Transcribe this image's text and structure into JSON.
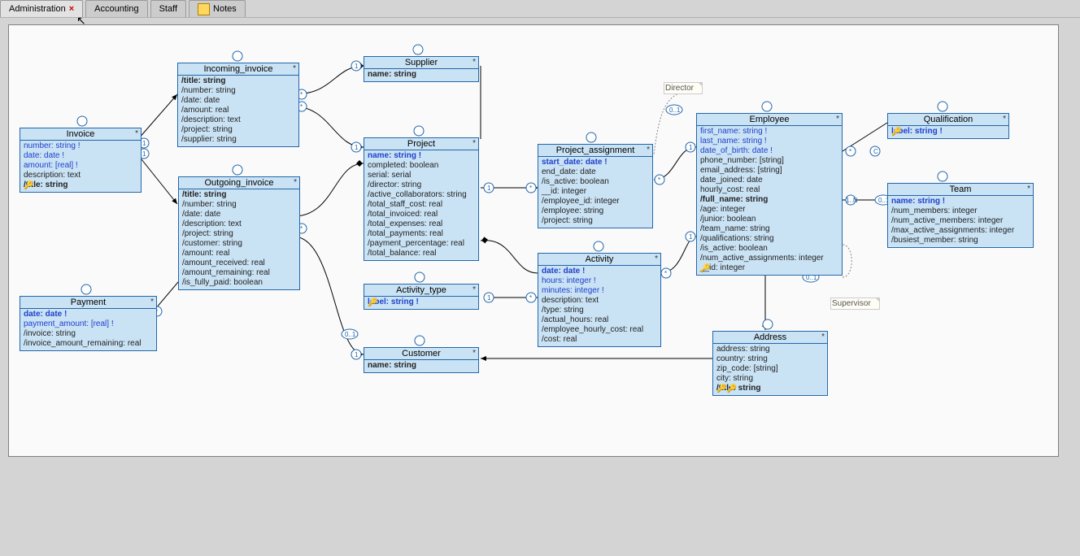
{
  "tabs": [
    "Administration",
    "Accounting",
    "Staff",
    "Notes"
  ],
  "labels": {
    "director": "Director",
    "supervisor": "Supervisor"
  },
  "entities": {
    "invoice": {
      "title": "Invoice",
      "attrs": [
        {
          "t": "number: string !",
          "blue": true
        },
        {
          "t": "date: date !",
          "blue": true
        },
        {
          "t": "amount: [real] !",
          "blue": true
        },
        {
          "t": "description: text"
        },
        {
          "t": "/title: string",
          "bold": true
        }
      ]
    },
    "incoming": {
      "title": "Incoming_invoice",
      "attrs": [
        {
          "t": "/title: string",
          "bold": true
        },
        {
          "t": "/number: string"
        },
        {
          "t": "/date: date"
        },
        {
          "t": "/amount: real"
        },
        {
          "t": "/description: text"
        },
        {
          "t": "/project: string"
        },
        {
          "t": "/supplier: string"
        }
      ]
    },
    "outgoing": {
      "title": "Outgoing_invoice",
      "attrs": [
        {
          "t": "/title: string",
          "bold": true
        },
        {
          "t": "/number: string"
        },
        {
          "t": "/date: date"
        },
        {
          "t": "/description: text"
        },
        {
          "t": "/project: string"
        },
        {
          "t": "/customer: string"
        },
        {
          "t": "/amount: real"
        },
        {
          "t": "/amount_received: real"
        },
        {
          "t": "/amount_remaining: real"
        },
        {
          "t": "/is_fully_paid: boolean"
        }
      ]
    },
    "payment": {
      "title": "Payment",
      "attrs": [
        {
          "t": "date: date !",
          "blue": true,
          "bold": true
        },
        {
          "t": "payment_amount: [real] !",
          "blue": true
        },
        {
          "t": "/invoice: string"
        },
        {
          "t": "/invoice_amount_remaining: real"
        }
      ]
    },
    "supplier": {
      "title": "Supplier",
      "attrs": [
        {
          "t": "name: string",
          "bold": true
        }
      ]
    },
    "project": {
      "title": "Project",
      "attrs": [
        {
          "t": "name: string !",
          "blue": true,
          "bold": true
        },
        {
          "t": "completed: boolean"
        },
        {
          "t": "serial: serial"
        },
        {
          "t": "/director: string"
        },
        {
          "t": "/active_collaborators: string"
        },
        {
          "t": "/total_staff_cost: real"
        },
        {
          "t": "/total_invoiced: real"
        },
        {
          "t": "/total_expenses: real"
        },
        {
          "t": "/total_payments: real"
        },
        {
          "t": "/payment_percentage: real"
        },
        {
          "t": "/total_balance: real"
        }
      ]
    },
    "customer": {
      "title": "Customer",
      "attrs": [
        {
          "t": "name: string",
          "bold": true
        }
      ]
    },
    "activitytype": {
      "title": "Activity_type",
      "attrs": [
        {
          "t": "label: string !",
          "blue": true,
          "bold": true
        }
      ]
    },
    "activity": {
      "title": "Activity",
      "attrs": [
        {
          "t": "date: date !",
          "blue": true,
          "bold": true
        },
        {
          "t": "hours: integer !",
          "blue": true
        },
        {
          "t": "minutes: integer !",
          "blue": true
        },
        {
          "t": "description: text"
        },
        {
          "t": "/type: string"
        },
        {
          "t": "/actual_hours: real"
        },
        {
          "t": "/employee_hourly_cost: real"
        },
        {
          "t": "/cost: real"
        }
      ]
    },
    "pa": {
      "title": "Project_assignment",
      "attrs": [
        {
          "t": "start_date: date !",
          "blue": true,
          "bold": true
        },
        {
          "t": "end_date: date"
        },
        {
          "t": "/is_active: boolean"
        },
        {
          "t": "__id: integer"
        },
        {
          "t": "/employee_id: integer"
        },
        {
          "t": "/employee: string"
        },
        {
          "t": "/project: string"
        }
      ]
    },
    "employee": {
      "title": "Employee",
      "attrs": [
        {
          "t": "first_name: string !",
          "blue": true
        },
        {
          "t": "last_name: string !",
          "blue": true
        },
        {
          "t": "date_of_birth: date !",
          "blue": true
        },
        {
          "t": "phone_number: [string]"
        },
        {
          "t": "email_address: [string]"
        },
        {
          "t": "date_joined: date"
        },
        {
          "t": "hourly_cost: real"
        },
        {
          "t": "/full_name: string",
          "bold": true
        },
        {
          "t": "/age: integer"
        },
        {
          "t": "/junior: boolean"
        },
        {
          "t": "/team_name: string"
        },
        {
          "t": "/qualifications: string"
        },
        {
          "t": "/is_active: boolean"
        },
        {
          "t": "/num_active_assignments: integer"
        },
        {
          "t": "__id: integer"
        }
      ]
    },
    "qualification": {
      "title": "Qualification",
      "attrs": [
        {
          "t": "label: string !",
          "blue": true,
          "bold": true
        }
      ]
    },
    "team": {
      "title": "Team",
      "attrs": [
        {
          "t": "name: string !",
          "blue": true,
          "bold": true
        },
        {
          "t": "/num_members: integer"
        },
        {
          "t": "/num_active_members: integer"
        },
        {
          "t": "/max_active_assignments: integer"
        },
        {
          "t": "/busiest_member: string"
        }
      ]
    },
    "address": {
      "title": "Address",
      "attrs": [
        {
          "t": "address: string"
        },
        {
          "t": "country: string"
        },
        {
          "t": "zip_code: [string]"
        },
        {
          "t": "city: string"
        },
        {
          "t": "/title: string",
          "bold": true
        }
      ]
    }
  }
}
